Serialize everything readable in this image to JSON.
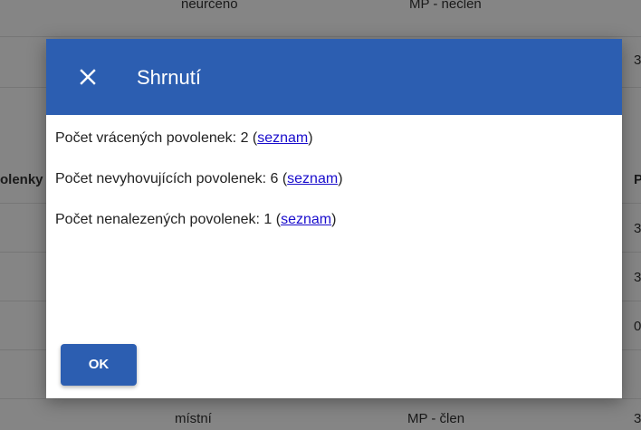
{
  "background_table": {
    "header_partial_left": "olenky",
    "header_partial_right": "P",
    "top_row": {
      "col1": "neurčeno",
      "col2": "MP - nečlen"
    },
    "bottom_row": {
      "col1": "místní",
      "col2": "MP - člen",
      "col3": "3"
    },
    "right_column_values": [
      "3",
      "3",
      "3",
      "0"
    ]
  },
  "dialog": {
    "title": "Shrnutí",
    "close_icon": "close-icon",
    "lines": [
      {
        "text": "Počet vrácených povolenek: 2 (",
        "link": "seznam",
        "suffix": ")"
      },
      {
        "text": "Počet nevyhovujících povolenek: 6 (",
        "link": "seznam",
        "suffix": ")"
      },
      {
        "text": "Počet nenalezených povolenek: 1 (",
        "link": "seznam",
        "suffix": ")"
      }
    ],
    "ok_label": "OK"
  },
  "colors": {
    "header_blue": "#2c5eb1",
    "link": "#1a0dcc"
  }
}
